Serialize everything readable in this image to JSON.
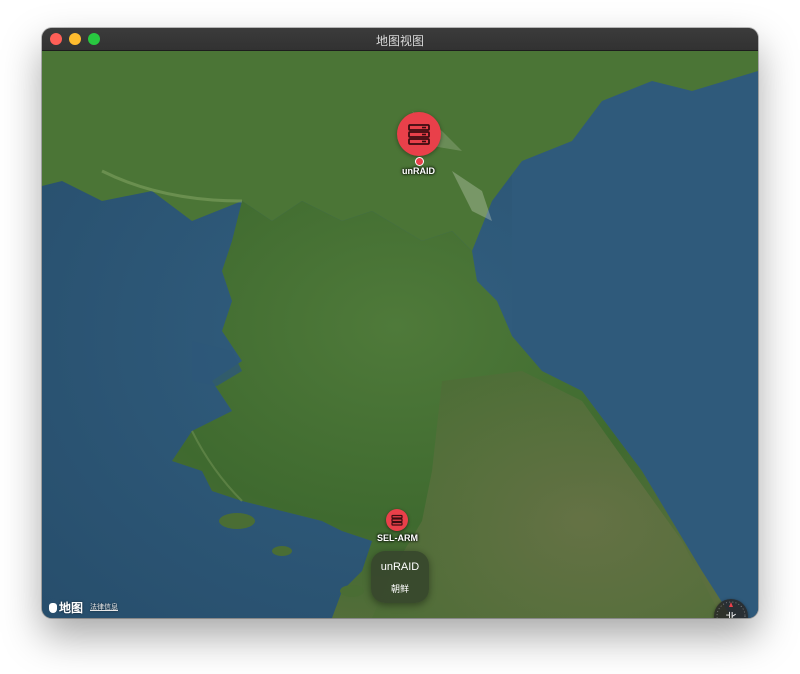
{
  "window": {
    "title": "地图视图"
  },
  "map": {
    "pins": [
      {
        "label": "unRAID",
        "icon": "server-icon",
        "color": "#e9404a"
      },
      {
        "label": "SEL-ARM",
        "icon": "server-icon",
        "color": "#e9404a"
      }
    ],
    "callout": {
      "title": "unRAID",
      "subtitle": "朝鲜"
    },
    "brand": "地图",
    "legal_link": "法律信息",
    "compass_label": "北"
  }
}
